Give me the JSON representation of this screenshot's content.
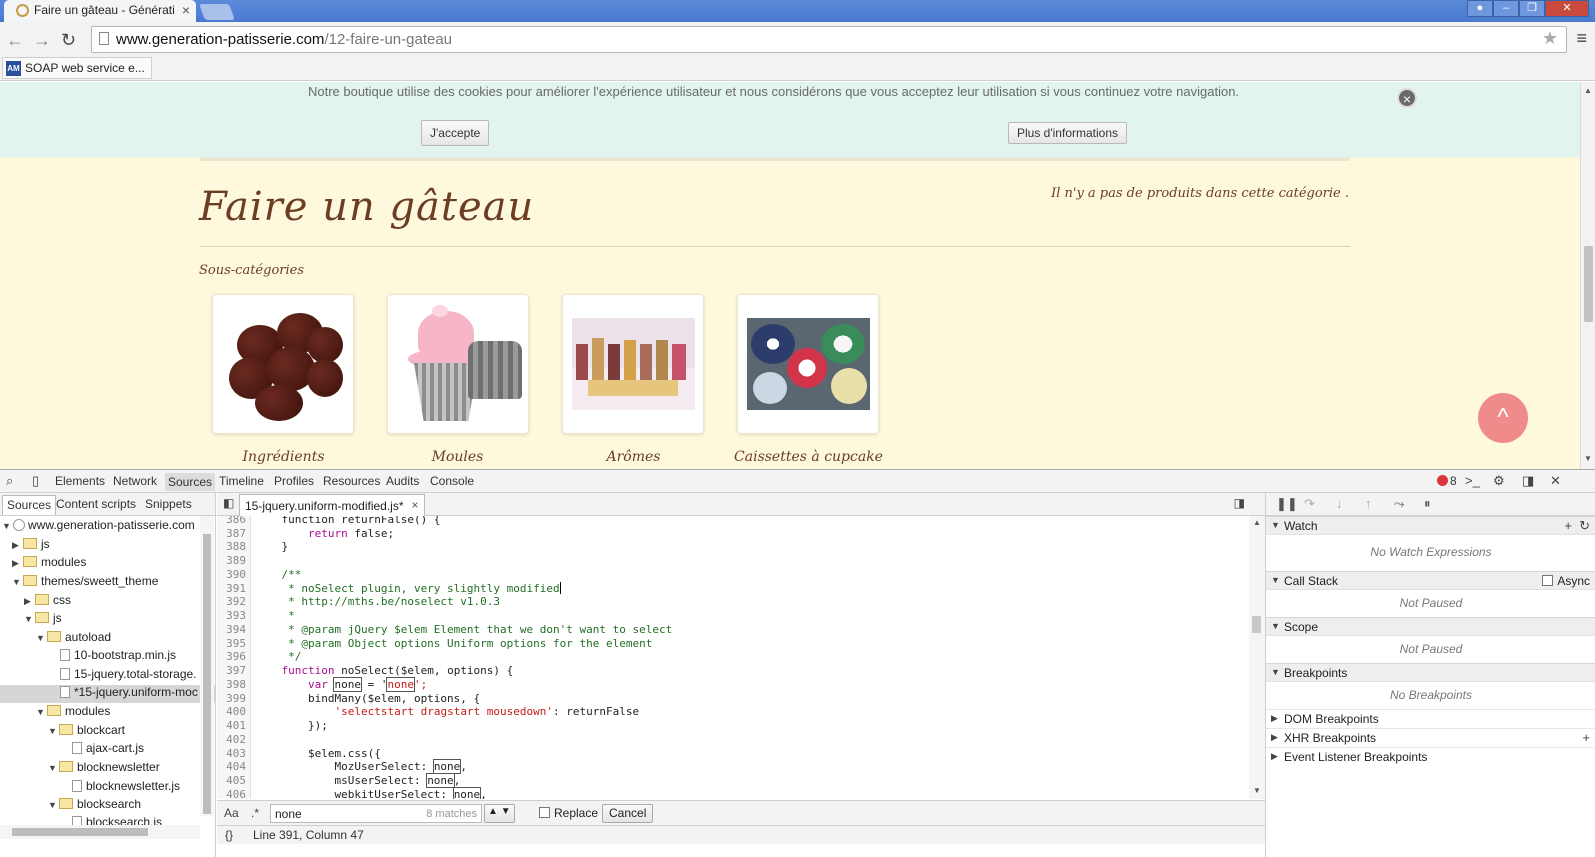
{
  "browser": {
    "tab_title": "Faire un gâteau - Générati",
    "tab_close": "×",
    "url_host": "www.generation-patisserie.com",
    "url_path": "/12-faire-un-gateau",
    "bookmark_badge": "AM",
    "bookmark_label": "SOAP web service e..."
  },
  "page": {
    "cookie_text": "Notre boutique utilise des cookies pour améliorer l'expérience utilisateur et nous considérons que vous acceptez leur utilisation si vous continuez votre navigation.",
    "accept_label": "J'accepte",
    "more_info_label": "Plus d'informations",
    "close_glyph": "×",
    "title": "Faire un gâteau",
    "no_products": "Il n'y a pas de produits dans cette catégorie .",
    "subcategories_title": "Sous-catégories",
    "categories": [
      {
        "label": "Ingrédients"
      },
      {
        "label": "Moules"
      },
      {
        "label": "Arômes"
      },
      {
        "label": "Caissettes à cupcake"
      }
    ],
    "scroll_top_glyph": "^"
  },
  "devtools": {
    "panel_tabs": [
      "Elements",
      "Network",
      "Sources",
      "Timeline",
      "Profiles",
      "Resources",
      "Audits",
      "Console"
    ],
    "active_tab": "Sources",
    "error_count": "8",
    "navigator_tabs": [
      "Sources",
      "Content scripts",
      "Snippets"
    ],
    "tree": [
      {
        "label": "www.generation-patisserie.com"
      },
      {
        "label": "js"
      },
      {
        "label": "modules"
      },
      {
        "label": "themes/sweett_theme"
      },
      {
        "label": "css"
      },
      {
        "label": "js"
      },
      {
        "label": "autoload"
      },
      {
        "label": "10-bootstrap.min.js"
      },
      {
        "label": "15-jquery.total-storage."
      },
      {
        "label": "*15-jquery.uniform-moc"
      },
      {
        "label": "modules"
      },
      {
        "label": "blockcart"
      },
      {
        "label": "ajax-cart.js"
      },
      {
        "label": "blocknewsletter"
      },
      {
        "label": "blocknewsletter.js"
      },
      {
        "label": "blocksearch"
      },
      {
        "label": "blocksearch.js"
      }
    ],
    "open_file": "15-jquery.uniform-modified.js*",
    "code": {
      "line_numbers": [
        "386",
        "387",
        "388",
        "389",
        "390",
        "391",
        "392",
        "393",
        "394",
        "395",
        "396",
        "397",
        "398",
        "399",
        "400",
        "401",
        "402",
        "403",
        "404",
        "405",
        "406"
      ],
      "l386": "    function returnFalse() {",
      "l387_kw": "return",
      "l387_rest": " false;",
      "l388": "    }",
      "l390": "    /**",
      "l391": "     * noSelect plugin, very slightly modified",
      "l392": "     * http://mths.be/noselect v1.0.3",
      "l393": "     *",
      "l394": "     * @param jQuery $elem Element that we don't want to select",
      "l395": "     * @param Object options Uniform options for the element",
      "l396": "     */",
      "l397_kw": "function",
      "l397_rest": " noSelect($elem, options) {",
      "l398_kw": "var",
      "l398_var": "none",
      "l398_eq": " = '",
      "l398_str": "none",
      "l398_end": "';",
      "l399": "        bindMany($elem, options, {",
      "l400_str": "'selectstart dragstart mousedown'",
      "l400_rest": ": returnFalse",
      "l401": "        });",
      "l403": "        $elem.css({",
      "l404_prop": "            MozUserSelect: ",
      "l404_val": "none",
      "l404_end": ",",
      "l405_prop": "            msUserSelect: ",
      "l405_val": "none",
      "l405_end": ",",
      "l406_prop": "            webkitUserSelect: ",
      "l406_val": "none",
      "l406_end": ","
    },
    "search": {
      "case_label": "Aa",
      "regex_label": ".*",
      "query": "none",
      "matches": "8 matches",
      "replace_label": "Replace",
      "cancel_label": "Cancel"
    },
    "status": "Line 391, Column 47",
    "status_braces": "{}",
    "debugger": {
      "watch": "Watch",
      "watch_empty": "No Watch Expressions",
      "call_stack": "Call Stack",
      "async_label": "Async",
      "not_paused": "Not Paused",
      "scope": "Scope",
      "scope_empty": "Not Paused",
      "breakpoints": "Breakpoints",
      "breakpoints_empty": "No Breakpoints",
      "dom_breakpoints": "DOM Breakpoints",
      "xhr_breakpoints": "XHR Breakpoints",
      "event_breakpoints": "Event Listener Breakpoints"
    }
  },
  "colors": {
    "page_bg": "#fef8dc",
    "cookie_bg": "#e2f4ef",
    "title_brown": "#6b3d22",
    "scroll_top": "#f08b8b",
    "chrome_blue": "#4a7ad0"
  }
}
